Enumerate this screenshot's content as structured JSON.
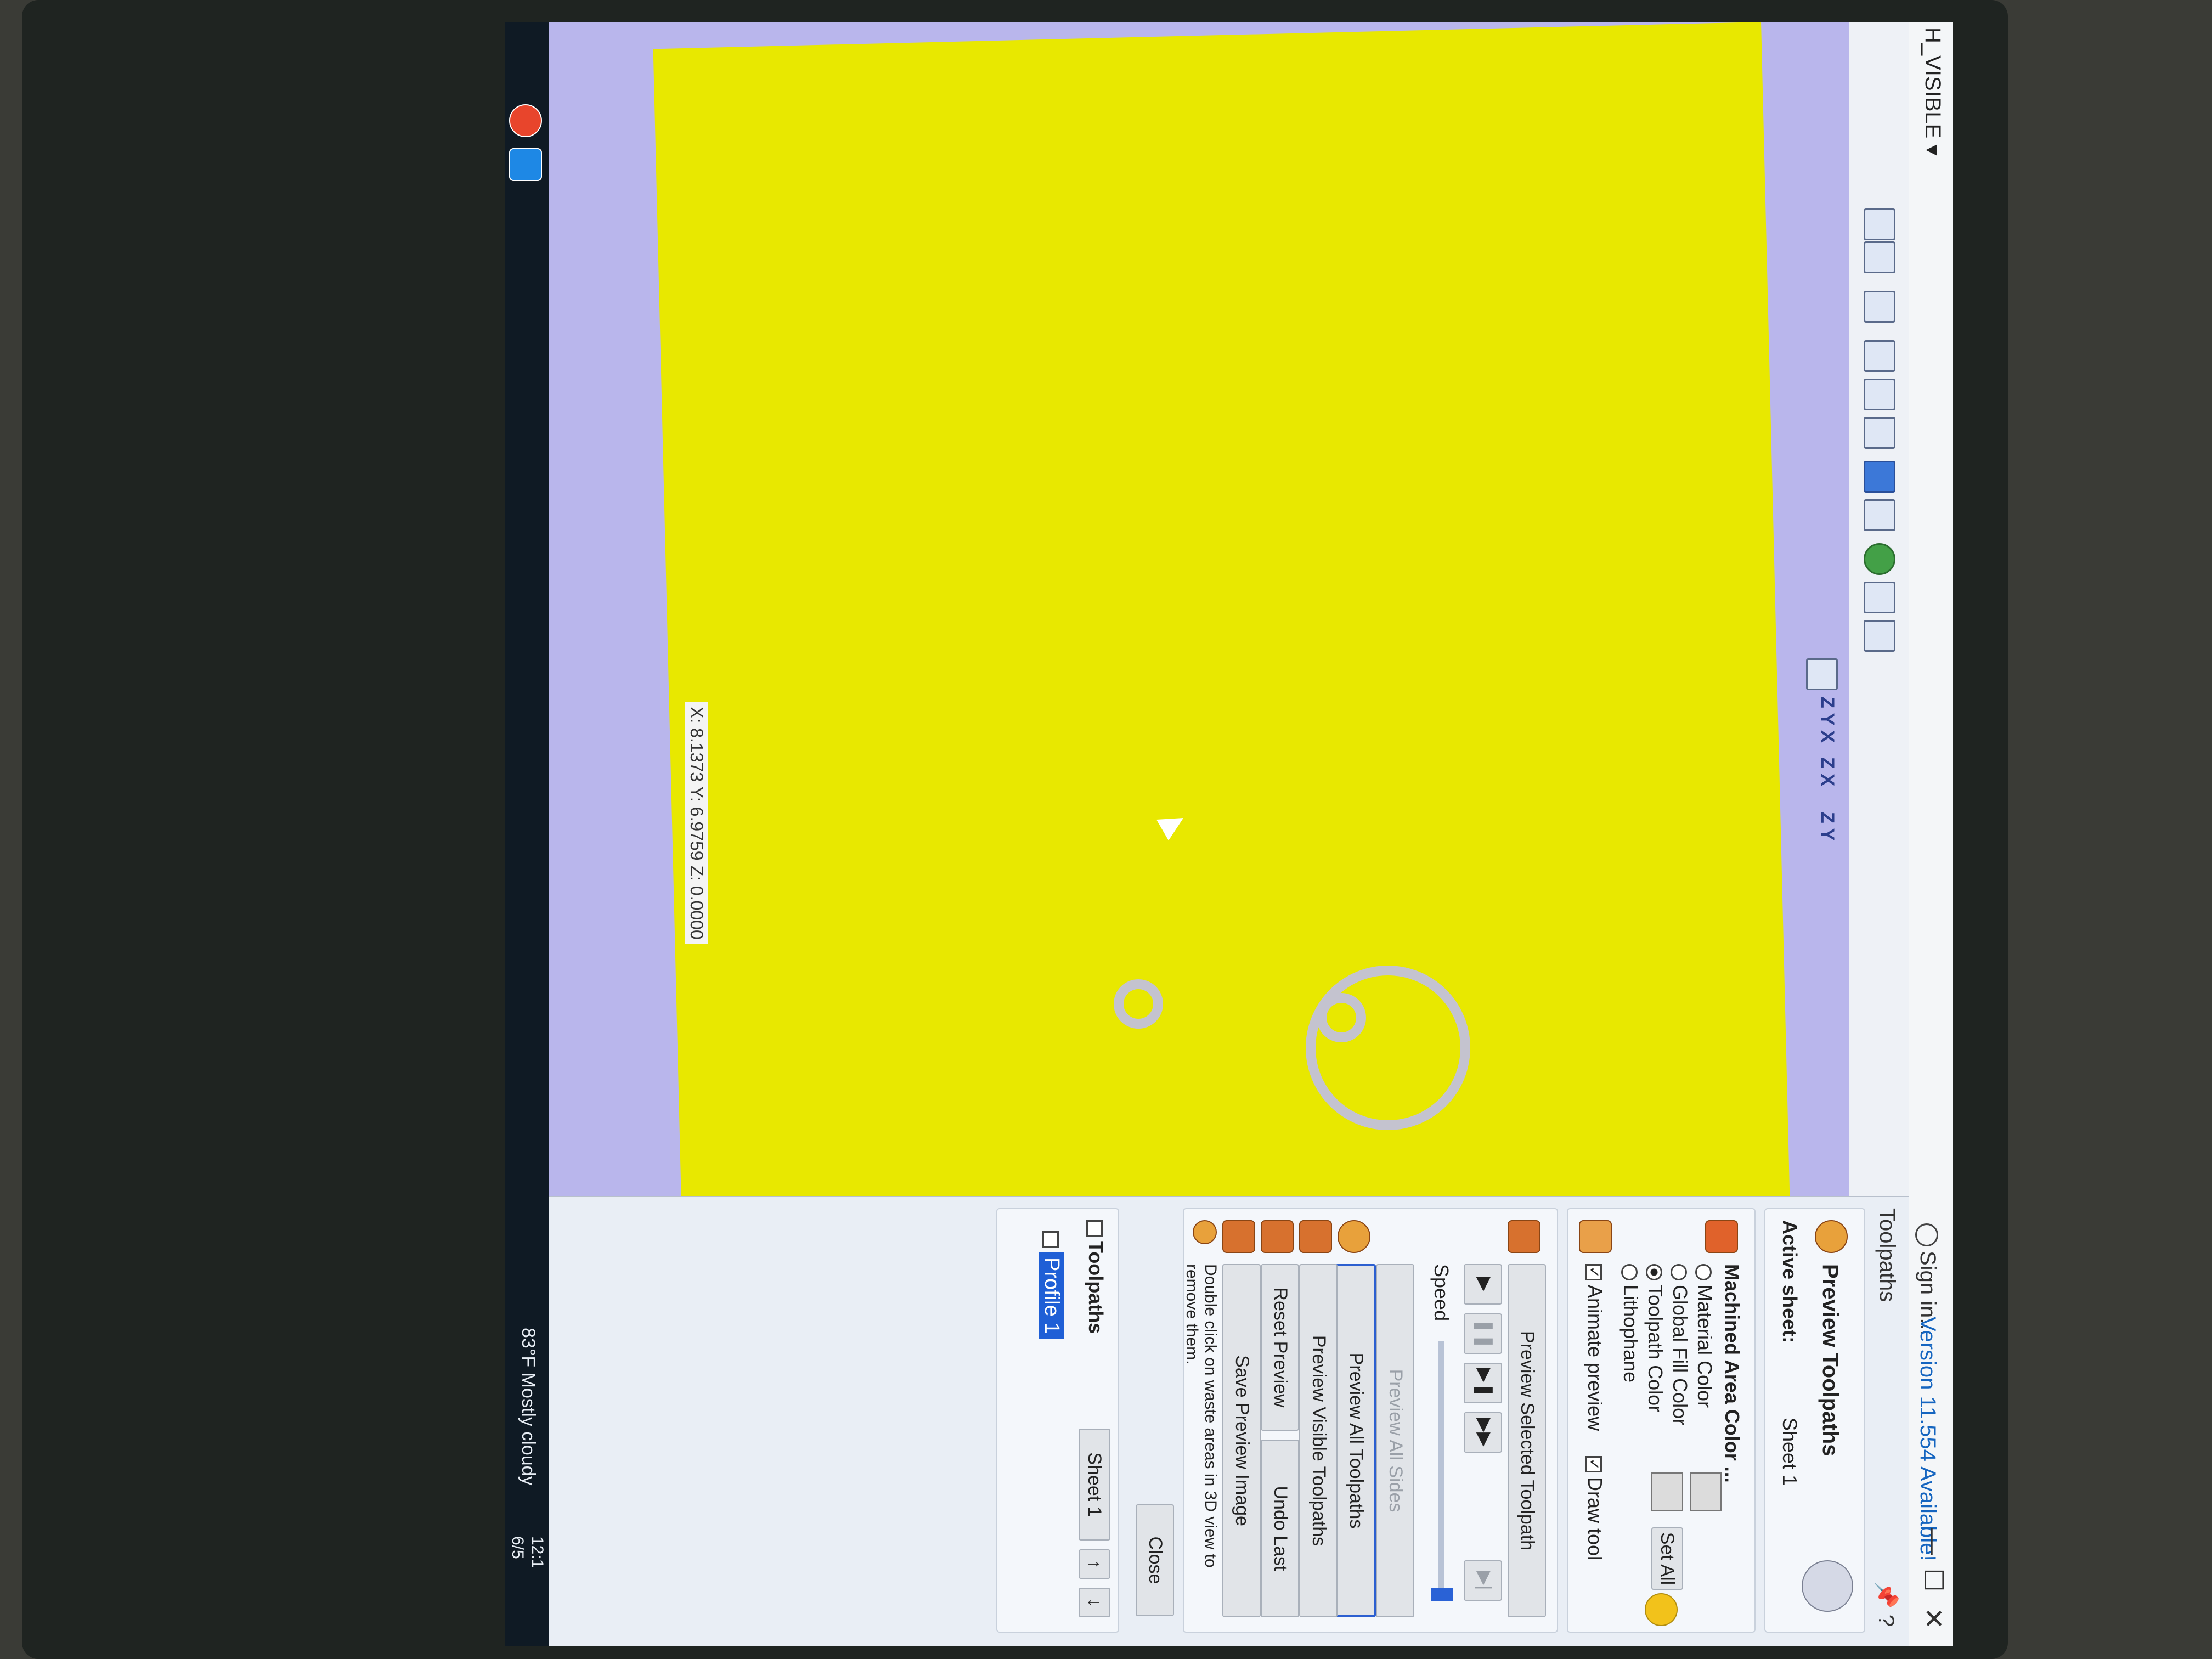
{
  "window": {
    "menu_visible": "H_VISIBLE ▾",
    "sign_in": "Sign in...",
    "version_notice": "Version 11.554 Available!",
    "minimize": "—",
    "maximize": "☐",
    "close": "✕"
  },
  "toolbar": {
    "icons": [
      "window-icon",
      "grid-icon",
      "pan-icon",
      "zoom-fit-icon",
      "zoom-box-icon",
      "zoom-icon",
      "refresh-icon",
      "snap-icon",
      "green-dot-icon",
      "layers-icon",
      "render-icon",
      "view-iso-icon",
      "view-top-icon",
      "view-front-icon",
      "view-side-icon"
    ],
    "axis_labels": [
      "Z Y X",
      "Z X",
      "Z Y",
      "Z X"
    ]
  },
  "view3d": {
    "status_coords": "X: 8.1373 Y: 6.9759 Z: 0.0000",
    "material_color": "#e8e800",
    "background_color": "#b9b6ec",
    "rings_color": "#c4c3cf"
  },
  "panel": {
    "tab_label": "Toolpaths",
    "pin": "📌 ?",
    "title": "Preview Toolpaths",
    "active_sheet_label": "Active sheet:",
    "active_sheet_value": "Sheet 1",
    "machined_area_color_label": "Machined Area Color ...",
    "color_options": [
      "Material Color",
      "Global Fill Color",
      "Toolpath Color",
      "Lithophane"
    ],
    "selected_color_option": "Toolpath Color",
    "set_all": "Set All",
    "animate_preview": "Animate preview",
    "draw_tool": "Draw tool",
    "preview_selected": "Preview Selected Toolpath",
    "speed_label": "Speed",
    "preview_all_sides": "Preview All Sides",
    "preview_all": "Preview All Toolpaths",
    "preview_visible": "Preview Visible Toolpaths",
    "reset_preview": "Reset Preview",
    "undo_last": "Undo Last",
    "save_preview_image": "Save Preview Image",
    "hint": "Double click on waste areas in 3D view to remove them.",
    "close": "Close"
  },
  "tree": {
    "title": "Toolpaths",
    "sheet": "Sheet 1",
    "profile": "Profile 1"
  },
  "taskbar": {
    "weather": "83°F  Mostly cloudy",
    "time": "12:1",
    "date": "6/5"
  }
}
